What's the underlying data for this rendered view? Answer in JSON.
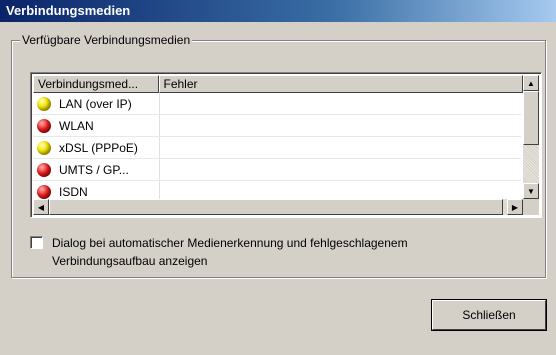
{
  "window": {
    "title": "Verbindungsmedien"
  },
  "group": {
    "label": "Verfügbare Verbindungsmedien"
  },
  "list": {
    "columns": [
      "Verbindungsmed...",
      "Fehler"
    ],
    "rows": [
      {
        "name": "LAN (over IP)",
        "status": "yellow",
        "error": ""
      },
      {
        "name": "WLAN",
        "status": "red",
        "error": ""
      },
      {
        "name": "xDSL (PPPoE)",
        "status": "yellow",
        "error": ""
      },
      {
        "name": "UMTS / GP...",
        "status": "red",
        "error": ""
      },
      {
        "name": "ISDN",
        "status": "red",
        "error": ""
      }
    ]
  },
  "option": {
    "label": "Dialog bei automatischer Medienerkennung und fehlgeschlagenem Verbindungsaufbau anzeigen",
    "checked": false
  },
  "buttons": {
    "close": "Schließen"
  },
  "colors": {
    "titlebar_start": "#0a246a",
    "titlebar_end": "#a6caf0",
    "dialog_bg": "#d4d0c8"
  }
}
